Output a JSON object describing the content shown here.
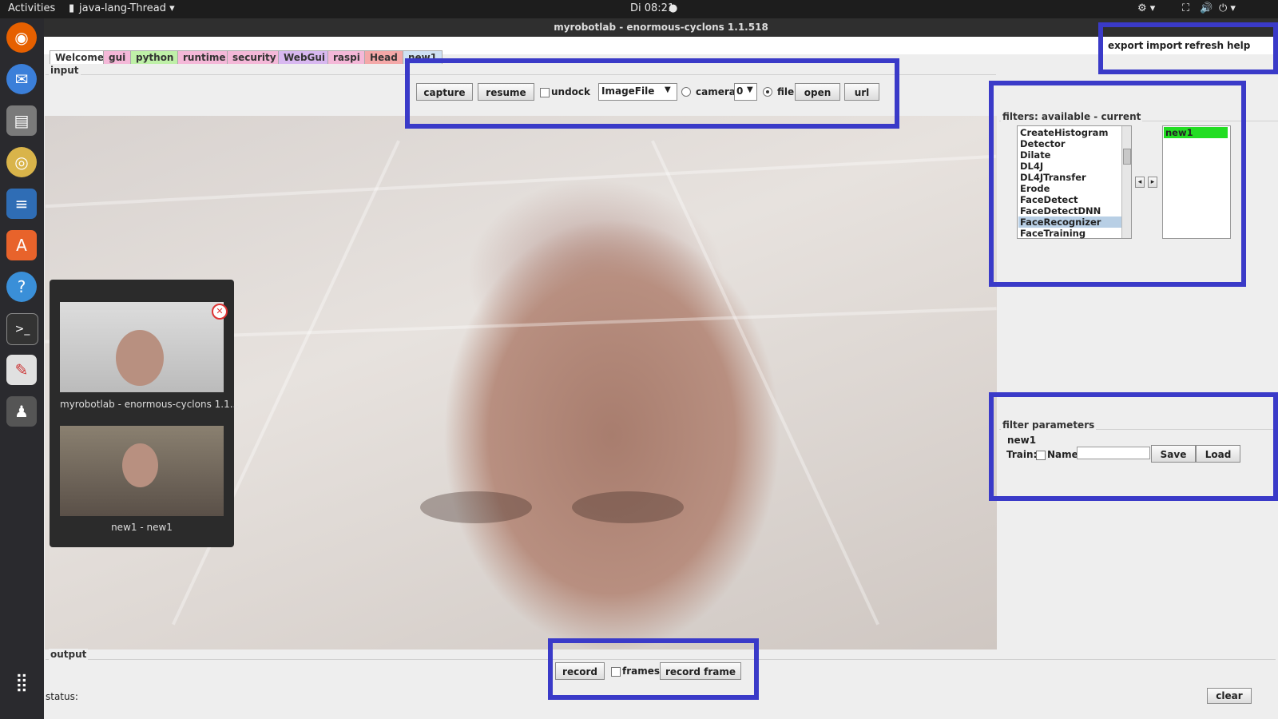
{
  "topbar": {
    "activities": "Activities",
    "app_name": "java-lang-Thread",
    "clock": "Di 08:21"
  },
  "window": {
    "title": "myrobotlab - enormous-cyclons 1.1.518"
  },
  "menu": {
    "export": "export",
    "import": "import",
    "refresh": "refresh",
    "help": "help"
  },
  "tabs": [
    {
      "label": "Welcome",
      "color": "#ffffff"
    },
    {
      "label": "gui",
      "color": "#f4b8d8"
    },
    {
      "label": "python",
      "color": "#bff0a8"
    },
    {
      "label": "runtime",
      "color": "#f4b8d8"
    },
    {
      "label": "security",
      "color": "#f4b8d8"
    },
    {
      "label": "WebGui",
      "color": "#d8b8f0"
    },
    {
      "label": "raspi",
      "color": "#f4b8d8"
    },
    {
      "label": "Head",
      "color": "#f4a8a8"
    },
    {
      "label": "new1",
      "color": "#cfe1f3"
    }
  ],
  "input": {
    "group_title": "input",
    "capture": "capture",
    "resume": "resume",
    "undock": "undock",
    "grabber_type": "ImageFile",
    "camera": "camera",
    "camera_index": "0",
    "file": "file",
    "open": "open",
    "url": "url"
  },
  "filters": {
    "group_title": "filters: available - current",
    "available": [
      "CreateHistogram",
      "Detector",
      "Dilate",
      "DL4J",
      "DL4JTransfer",
      "Erode",
      "FaceDetect",
      "FaceDetectDNN",
      "FaceRecognizer",
      "FaceTraining"
    ],
    "selected_available": "FaceRecognizer",
    "current": [
      "new1"
    ]
  },
  "filter_params": {
    "group_title": "filter parameters",
    "filter_name": "new1",
    "train": "Train:",
    "name_label": "Name:",
    "name_value": "",
    "save": "Save",
    "load": "Load"
  },
  "output": {
    "group_title": "output",
    "record": "record",
    "frames": "frames",
    "record_frame": "record frame"
  },
  "status": {
    "label": "status:",
    "clear": "clear"
  },
  "switcher": {
    "item1": "myrobotlab - enormous-cyclons 1.1...",
    "item2": "new1 - new1"
  },
  "colors": {
    "highlight": "#3a3ac8",
    "current_filter": "#22dd22"
  }
}
